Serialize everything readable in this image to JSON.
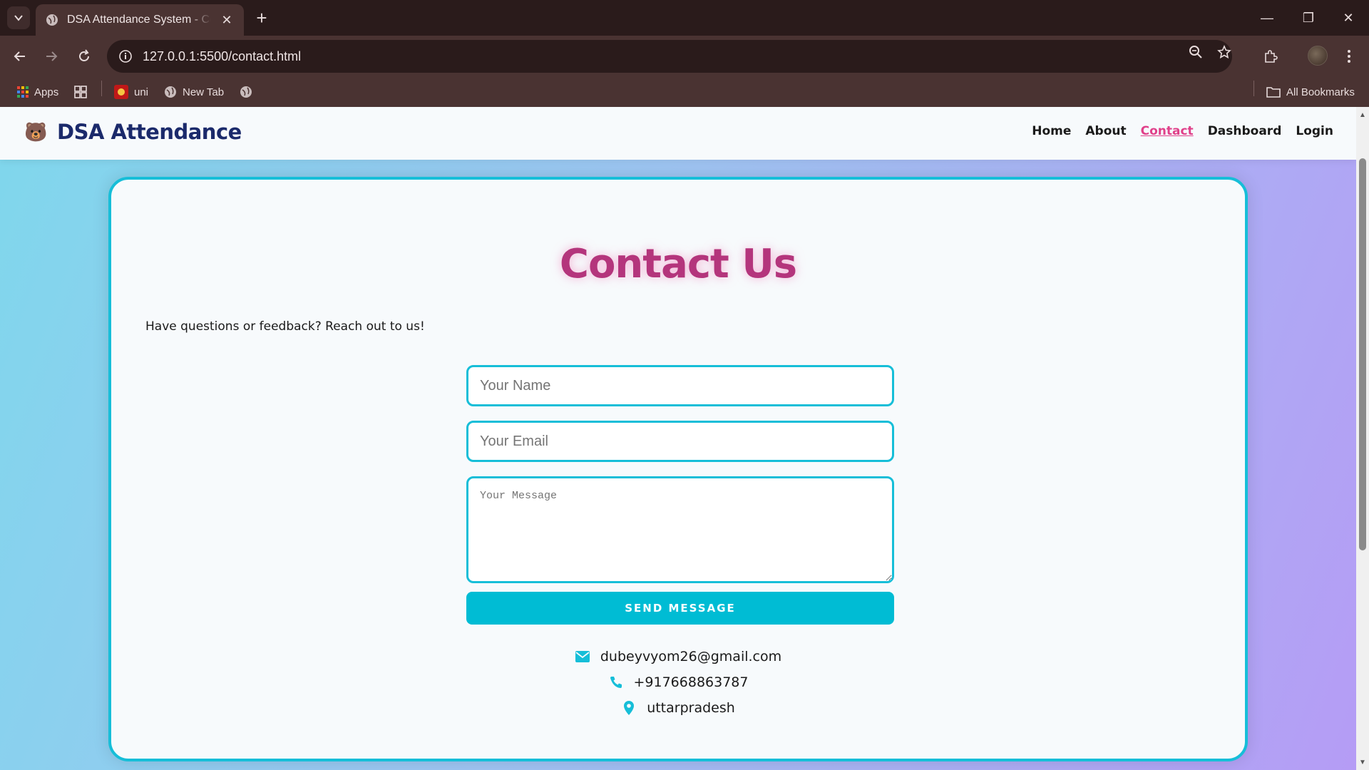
{
  "browser": {
    "tab_title": "DSA Attendance System - Contact",
    "url": "127.0.0.1:5500/contact.html",
    "bookmarks": [
      {
        "label": "Apps",
        "icon": "apps-grid-icon"
      },
      {
        "label": "",
        "icon": "tab-groups-icon"
      },
      {
        "label": "uni",
        "icon": "uni-favicon"
      },
      {
        "label": "New Tab",
        "icon": "globe-icon"
      },
      {
        "label": "",
        "icon": "globe-icon"
      }
    ],
    "all_bookmarks_label": "All Bookmarks"
  },
  "navbar": {
    "brand_icon": "🐻",
    "brand_title": "DSA Attendance",
    "links": [
      "Home",
      "About",
      "Contact",
      "Dashboard",
      "Login"
    ],
    "active_link": "Contact"
  },
  "contact": {
    "heading": "Contact Us",
    "subtext": "Have questions or feedback? Reach out to us!",
    "name_placeholder": "Your Name",
    "email_placeholder": "Your Email",
    "message_placeholder": "Your Message",
    "send_label": "SEND MESSAGE",
    "email": "dubeyvyom26@gmail.com",
    "phone": "+917668863787",
    "location": "uttarpradesh"
  },
  "colors": {
    "accent": "#16bed8",
    "brand": "#1b2a6b",
    "heading": "#b4357c",
    "active_link": "#e0408a"
  }
}
